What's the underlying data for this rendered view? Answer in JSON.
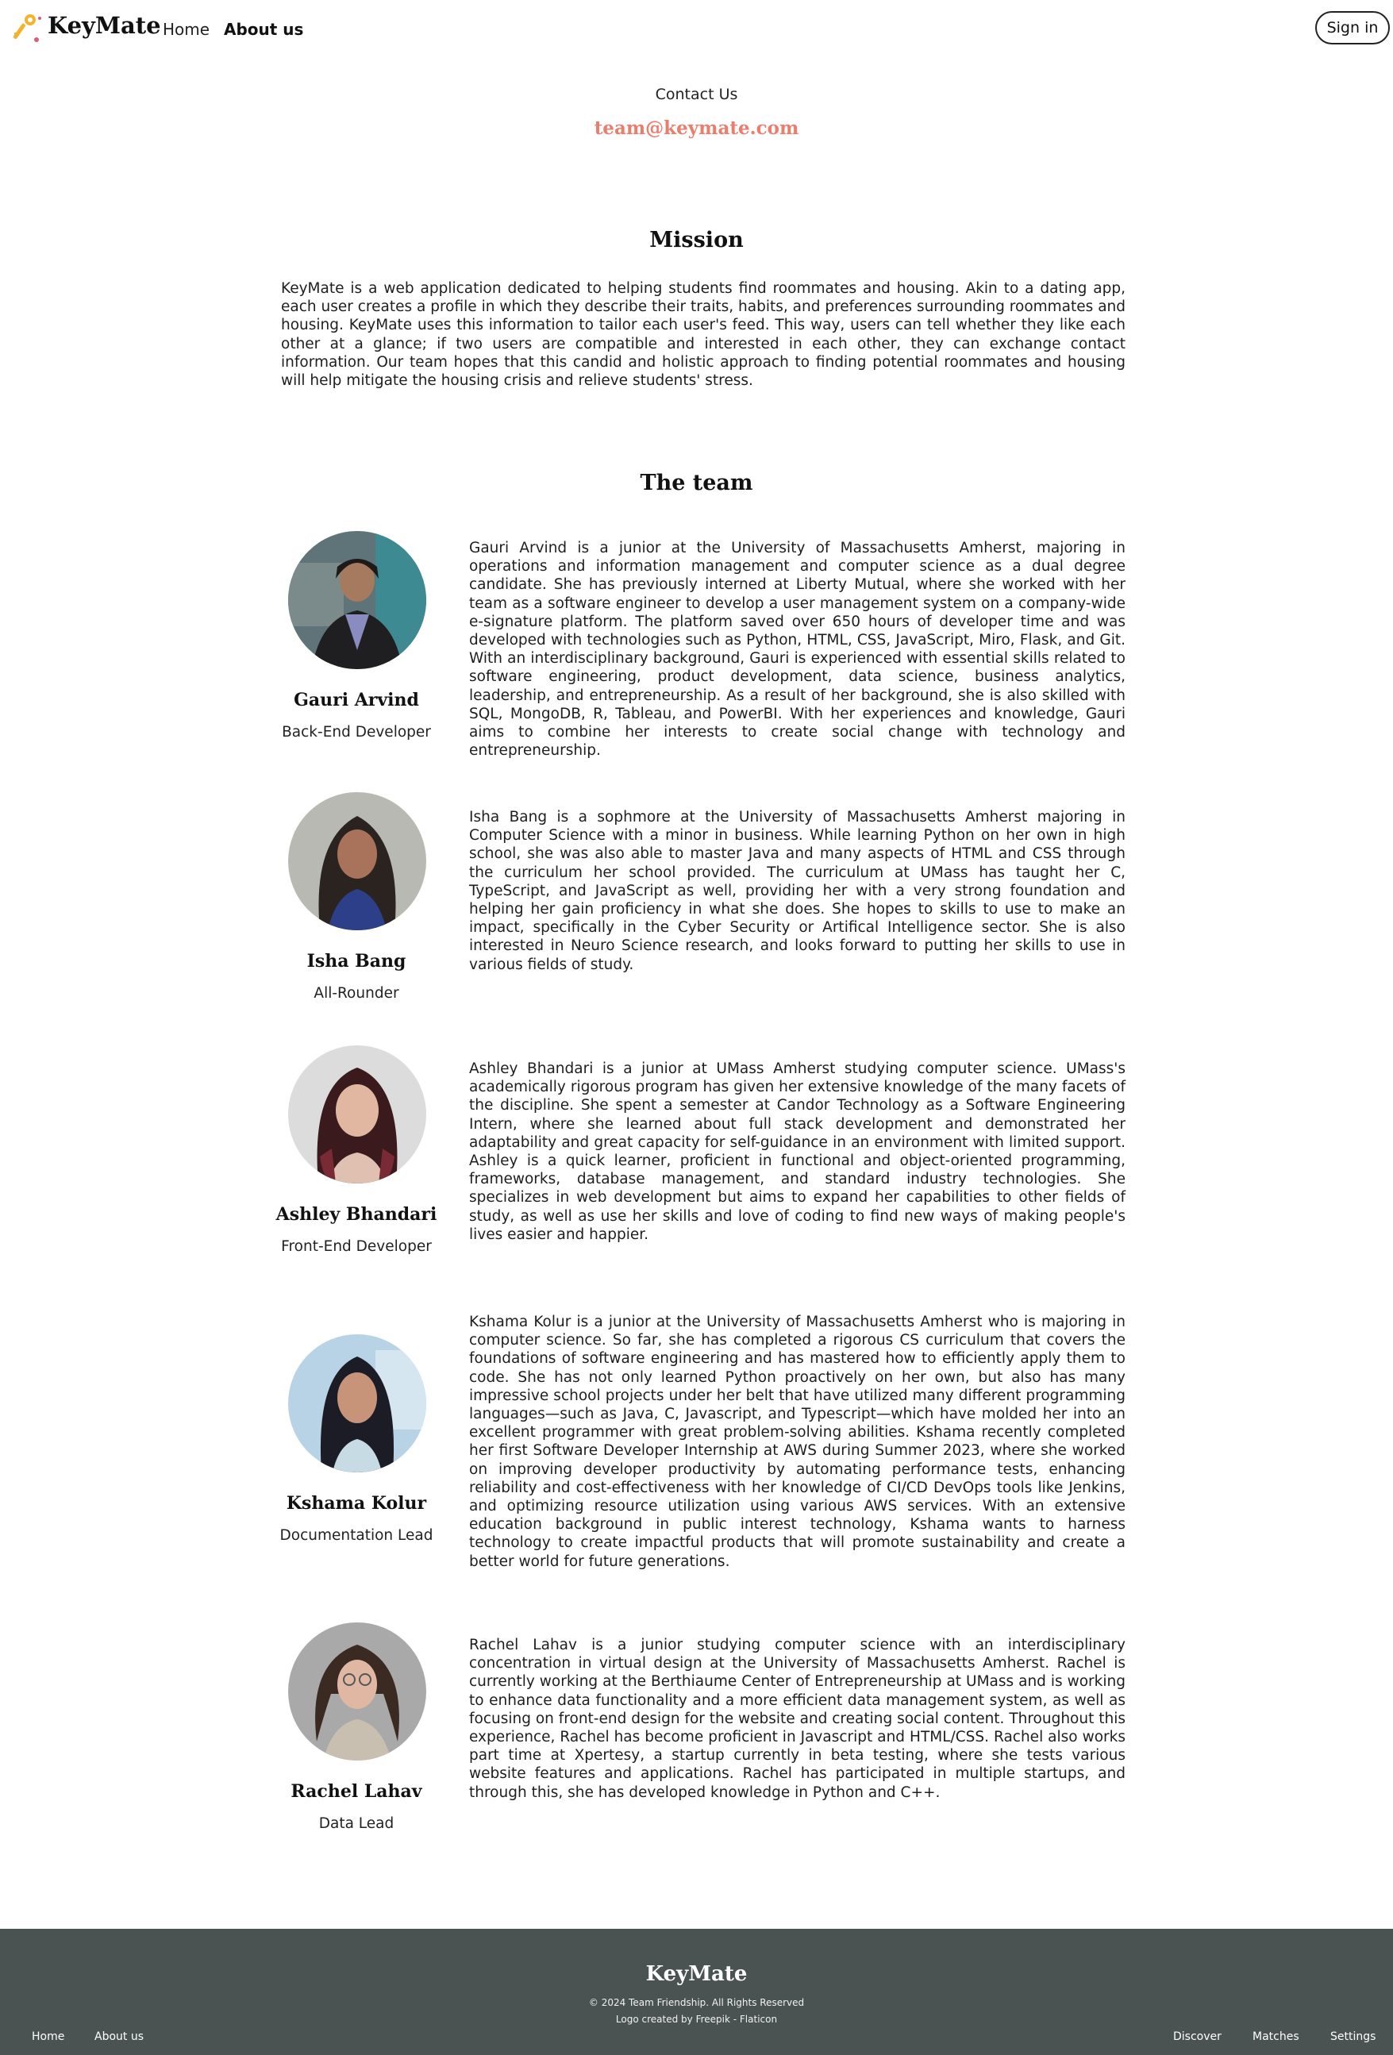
{
  "header": {
    "brand": "KeyMate",
    "nav": {
      "home": "Home",
      "about": "About us"
    },
    "signin_label": "Sign in"
  },
  "contact": {
    "label": "Contact Us",
    "email": "team@keymate.com"
  },
  "mission": {
    "title": "Mission",
    "text": "KeyMate is a web application dedicated to helping students find roommates and housing. Akin to a dating app, each user creates a profile in which they describe their traits, habits, and preferences surrounding roommates and housing. KeyMate uses this information to tailor each user's feed. This way, users can tell whether they like each other at a glance; if two users are compatible and interested in each other, they can exchange contact information. Our team hopes that this candid and holistic approach to finding potential roommates and housing will help mitigate the housing crisis and relieve students' stress."
  },
  "team": {
    "title": "The team",
    "members": [
      {
        "name": "Gauri Arvind",
        "role": "Back-End Developer",
        "bio": "Gauri Arvind is a junior at the University of Massachusetts Amherst, majoring in operations and information management and computer science as a dual degree candidate. She has previously interned at Liberty Mutual, where she worked with her team as a software engineer to develop a user management system on a company-wide e-signature platform. The platform saved over 650 hours of developer time and was developed with technologies such as Python, HTML, CSS, JavaScript, Miro, Flask, and Git. With an interdisciplinary background, Gauri is experienced with essential skills related to software engineering, product development, data science, business analytics, leadership, and entrepreneurship. As a result of her background, she is also skilled with SQL, MongoDB, R, Tableau, and PowerBI. With her experiences and knowledge, Gauri aims to combine her interests to create social change with technology and entrepreneurship."
      },
      {
        "name": "Isha Bang",
        "role": "All-Rounder",
        "bio": "Isha Bang is a sophmore at the University of Massachusetts Amherst majoring in Computer Science with a minor in business. While learning Python on her own in high school, she was also able to master Java and many aspects of HTML and CSS through the curriculum her school provided. The curriculum at UMass has taught her C, TypeScript, and JavaScript as well, providing her with a very strong foundation and helping her gain proficiency in what she does. She hopes to skills to use to make an impact, specifically in the Cyber Security or Artifical Intelligence sector. She is also interested in Neuro Science research, and looks forward to putting her skills to use in various fields of study."
      },
      {
        "name": "Ashley Bhandari",
        "role": "Front-End Developer",
        "bio": "Ashley Bhandari is a junior at UMass Amherst studying computer science. UMass's academically rigorous program has given her extensive knowledge of the many facets of the discipline. She spent a semester at Candor Technology as a Software Engineering Intern, where she learned about full stack development and demonstrated her adaptability and great capacity for self-guidance in an environment with limited support. Ashley is a quick learner, proficient in functional and object-oriented programming, frameworks, database management, and standard industry technologies. She specializes in web development but aims to expand her capabilities to other fields of study, as well as use her skills and love of coding to find new ways of making people's lives easier and happier."
      },
      {
        "name": "Kshama Kolur",
        "role": "Documentation Lead",
        "bio": "Kshama Kolur is a junior at the University of Massachusetts Amherst who is majoring in computer science. So far, she has completed a rigorous CS curriculum that covers the foundations of software engineering and has mastered how to efficiently apply them to code. She has not only learned Python proactively on her own, but also has many impressive school projects under her belt that have utilized many different programming languages—such as Java, C, Javascript, and Typescript—which have molded her into an excellent programmer with great problem-solving abilities. Kshama recently completed her first Software Developer Internship at AWS during Summer 2023, where she worked on improving developer productivity by automating performance tests, enhancing reliability and cost-effectiveness with her knowledge of CI/CD DevOps tools like Jenkins, and optimizing resource utilization using various AWS services. With an extensive education background in public interest technology, Kshama wants to harness technology to create impactful products that will promote sustainability and create a better world for future generations."
      },
      {
        "name": "Rachel Lahav",
        "role": "Data Lead",
        "bio": "Rachel Lahav is a junior studying computer science with an interdisciplinary concentration in virtual design at the University of Massachusetts Amherst. Rachel is currently working at the Berthiaume Center of Entrepreneurship at UMass and is working to enhance data functionality and a more efficient data management system, as well as focusing on front-end design for the website and creating social content. Throughout this experience, Rachel has become proficient in Javascript and HTML/CSS. Rachel also works part time at Xpertesy, a startup currently in beta testing, where she tests various website features and applications. Rachel has participated in multiple startups, and through this, she has developed knowledge in Python and C++."
      }
    ]
  },
  "footer": {
    "brand": "KeyMate",
    "copyright": "© 2024 Team Friendship. All Rights Reserved",
    "credit": "Logo created by Freepik - Flaticon",
    "links": {
      "home": "Home",
      "about": "About us",
      "discover": "Discover",
      "matches": "Matches",
      "settings": "Settings"
    }
  },
  "colors": {
    "accent": "#ec7d6c",
    "footer_bg": "#4b5252",
    "logo_key": "#f3b42d",
    "logo_dot": "#e05a7a"
  },
  "icons": {
    "logo": "key-logo-icon"
  }
}
